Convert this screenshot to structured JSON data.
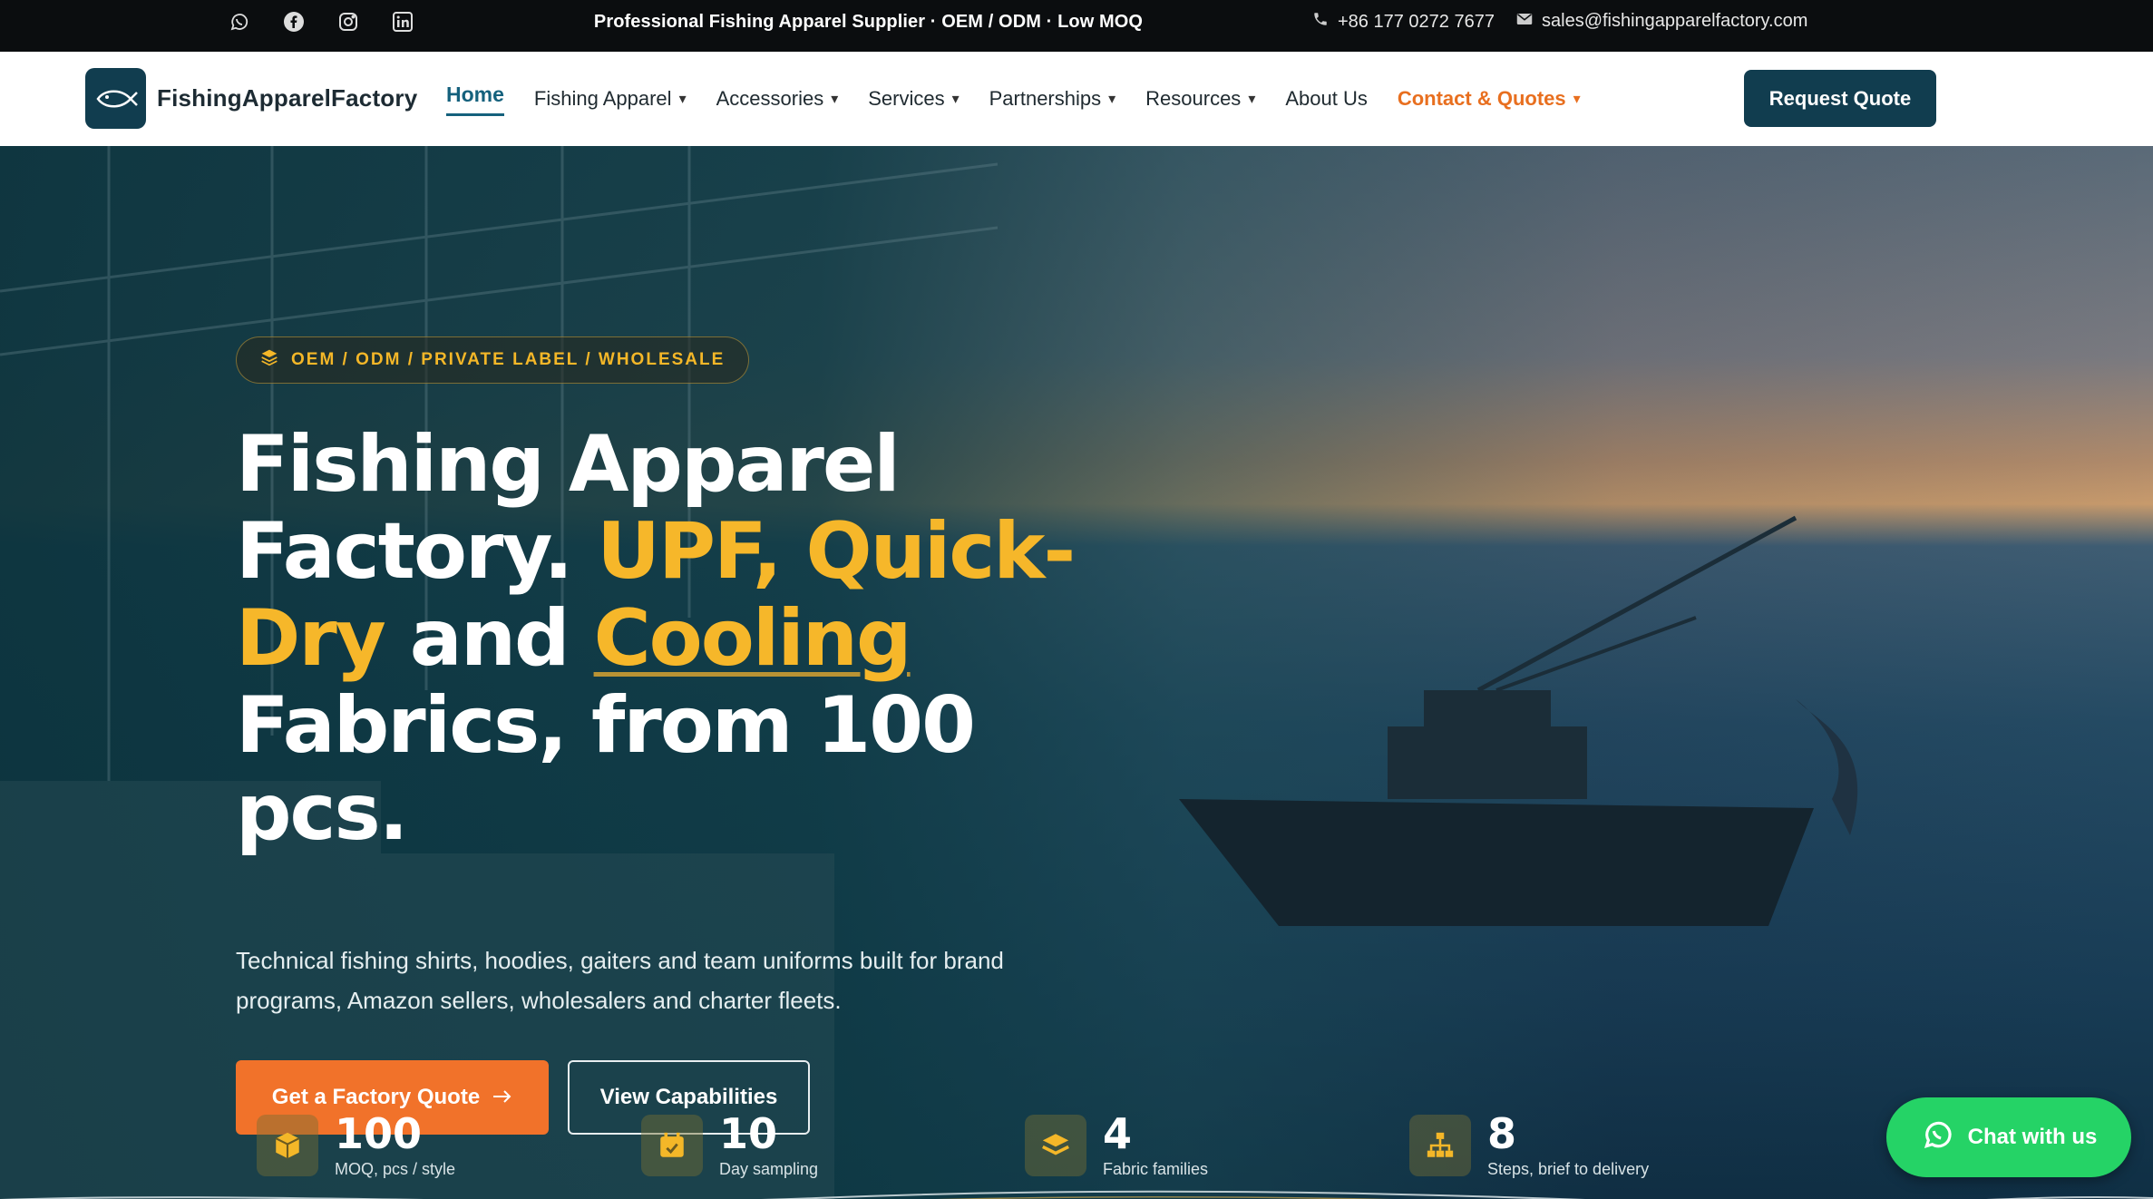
{
  "topbar": {
    "social": [
      "whatsapp-icon",
      "facebook-icon",
      "instagram-icon",
      "linkedin-icon"
    ],
    "tagline": "Professional Fishing Apparel Supplier · OEM / ODM · Low MOQ",
    "phone": "+86 177 0272 7677",
    "email": "sales@fishingapparelfactory.com"
  },
  "nav": {
    "logo_text": "FishingApparelFactory",
    "items": [
      {
        "label": "Home",
        "caret": ""
      },
      {
        "label": "Fishing Apparel",
        "caret": "▾"
      },
      {
        "label": "Accessories",
        "caret": "▾"
      },
      {
        "label": "Services",
        "caret": "▾"
      },
      {
        "label": "Partnerships",
        "caret": "▾"
      },
      {
        "label": "Resources",
        "caret": "▾"
      },
      {
        "label": "About Us",
        "caret": ""
      },
      {
        "label": "Contact & Quotes",
        "caret": "▾"
      }
    ],
    "cta": "Request Quote"
  },
  "hero": {
    "pill": "OEM / ODM / PRIVATE LABEL / WHOLESALE",
    "headline": {
      "part1": "Fishing Apparel Factory. ",
      "highlight1": "UPF, Quick-Dry",
      "part2": " and ",
      "highlight2": "Cooling",
      "part3": " Fabrics, from 100 pcs."
    },
    "subtext": "Technical fishing shirts, hoodies, gaiters and team uniforms built for brand programs, Amazon sellers, wholesalers and charter fleets.",
    "primary_button": "Get a Factory Quote",
    "secondary_button": "View Capabilities"
  },
  "stats": [
    {
      "value": "100",
      "label": "MOQ, pcs / style",
      "icon": "box-icon"
    },
    {
      "value": "10",
      "label": "Day sampling",
      "icon": "calendar-check-icon"
    },
    {
      "value": "4",
      "label": "Fabric families",
      "icon": "layers-icon"
    },
    {
      "value": "8",
      "label": "Steps, brief to delivery",
      "icon": "sitemap-icon"
    }
  ],
  "chat": {
    "label": "Chat with us"
  },
  "colors": {
    "accent": "#f6b72a",
    "brand": "#113d4f",
    "cta": "#f1722a",
    "whatsapp": "#25d366"
  }
}
